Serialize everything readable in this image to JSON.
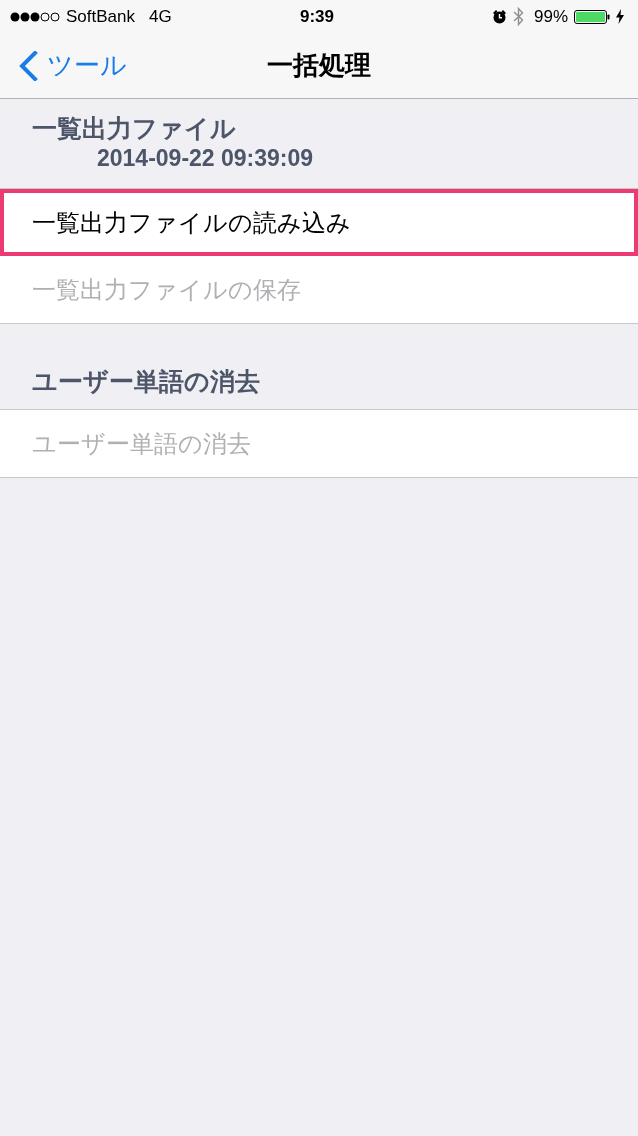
{
  "status_bar": {
    "carrier": "SoftBank",
    "network": "4G",
    "time": "9:39",
    "battery": "99%"
  },
  "nav_bar": {
    "back_label": "ツール",
    "title": "一括処理"
  },
  "sections": [
    {
      "header": "一覧出力ファイル",
      "subtitle": "2014-09-22 09:39:09",
      "rows": [
        {
          "label": "一覧出力ファイルの読み込み",
          "disabled": false,
          "highlighted": true
        },
        {
          "label": "一覧出力ファイルの保存",
          "disabled": true,
          "highlighted": false
        }
      ]
    },
    {
      "header": "ユーザー単語の消去",
      "rows": [
        {
          "label": "ユーザー単語の消去",
          "disabled": true,
          "highlighted": false
        }
      ]
    }
  ]
}
